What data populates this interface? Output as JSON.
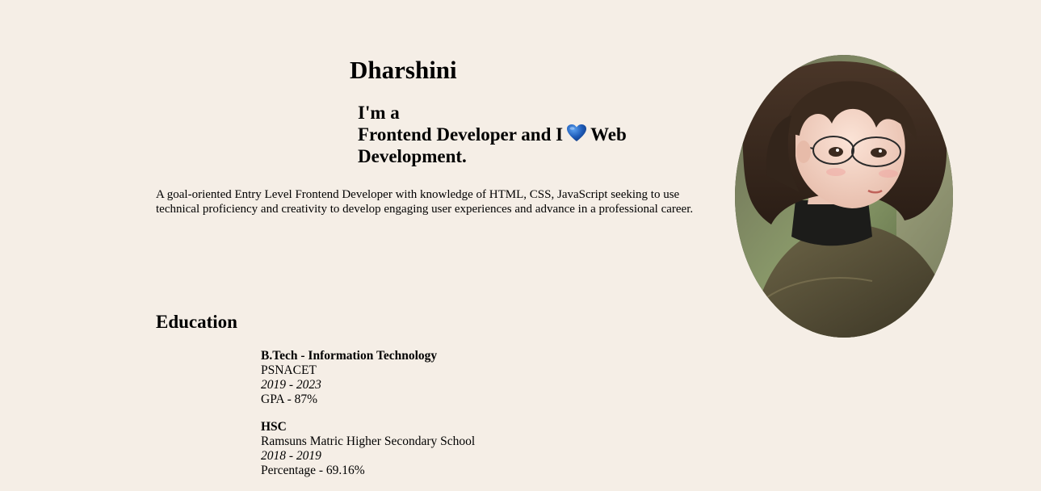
{
  "profile": {
    "name": "Dharshini",
    "intro_line1": "I'm a",
    "intro_role": "Frontend Developer and I",
    "intro_heart_icon": "blue-heart-icon",
    "intro_rest": "Web Development.",
    "summary": "A goal-oriented Entry Level Frontend Developer with knowledge of HTML, CSS, JavaScript seeking to use technical proficiency and creativity to develop engaging user experiences and advance in a professional career.",
    "photo_icon": "profile-photo"
  },
  "education": {
    "title": "Education",
    "items": [
      {
        "degree": "B.Tech - Information Technology",
        "school": "PSNACET",
        "years": "2019 - 2023",
        "score": "GPA - 87%"
      },
      {
        "degree": "HSC",
        "school": "Ramsuns Matric Higher Secondary School",
        "years": "2018 - 2019",
        "score": "Percentage - 69.16%"
      }
    ]
  },
  "colors": {
    "background": "#F5EEE6",
    "heart": "#1E5BB8",
    "text": "#000000"
  }
}
